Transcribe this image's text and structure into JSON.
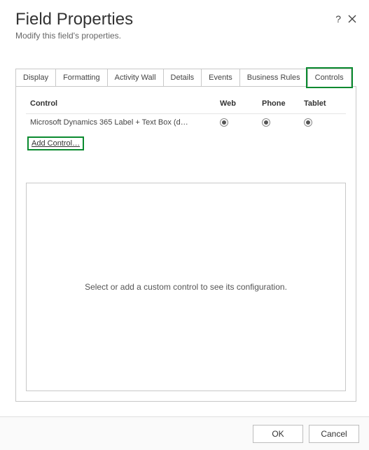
{
  "header": {
    "title": "Field Properties",
    "subtitle": "Modify this field's properties."
  },
  "tabs": {
    "items": [
      {
        "label": "Display"
      },
      {
        "label": "Formatting"
      },
      {
        "label": "Activity Wall"
      },
      {
        "label": "Details"
      },
      {
        "label": "Events"
      },
      {
        "label": "Business Rules"
      },
      {
        "label": "Controls"
      }
    ],
    "active_index": 6,
    "highlight_index": 6
  },
  "controls_pane": {
    "columns": {
      "control": "Control",
      "web": "Web",
      "phone": "Phone",
      "tablet": "Tablet"
    },
    "rows": [
      {
        "name": "Microsoft Dynamics 365 Label + Text Box (d…",
        "web_selected": true,
        "phone_selected": true,
        "tablet_selected": true
      }
    ],
    "add_control_label": "Add Control…",
    "config_placeholder": "Select or add a custom control to see its configuration."
  },
  "footer": {
    "ok": "OK",
    "cancel": "Cancel"
  }
}
